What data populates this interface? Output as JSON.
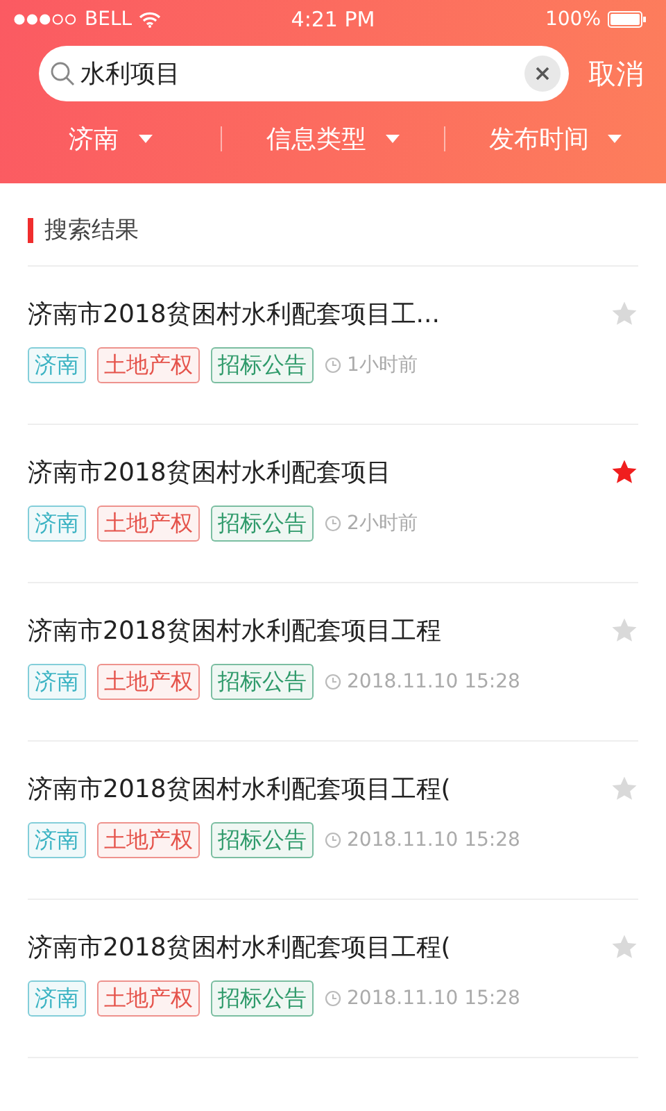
{
  "status_bar": {
    "carrier": "BELL",
    "time": "4:21 PM",
    "battery": "100%"
  },
  "search": {
    "value": "水利项目",
    "cancel": "取消"
  },
  "filters": [
    {
      "label": "济南"
    },
    {
      "label": "信息类型"
    },
    {
      "label": "发布时间"
    }
  ],
  "section_title": "搜索结果",
  "results": [
    {
      "title": "济南市2018贫困村水利配套项目工...",
      "starred": false,
      "tags": [
        {
          "label": "济南",
          "color": "#3bb3c3"
        },
        {
          "label": "土地产权",
          "color": "#e5534b"
        },
        {
          "label": "招标公告",
          "color": "#2e9a6a"
        }
      ],
      "time": "1小时前"
    },
    {
      "title": "济南市2018贫困村水利配套项目",
      "starred": true,
      "tags": [
        {
          "label": "济南",
          "color": "#3bb3c3"
        },
        {
          "label": "土地产权",
          "color": "#e5534b"
        },
        {
          "label": "招标公告",
          "color": "#2e9a6a"
        }
      ],
      "time": "2小时前"
    },
    {
      "title": "济南市2018贫困村水利配套项目工程",
      "starred": false,
      "tags": [
        {
          "label": "济南",
          "color": "#3bb3c3"
        },
        {
          "label": "土地产权",
          "color": "#e5534b"
        },
        {
          "label": "招标公告",
          "color": "#2e9a6a"
        }
      ],
      "time": "2018.11.10 15:28"
    },
    {
      "title": "济南市2018贫困村水利配套项目工程(",
      "starred": false,
      "tags": [
        {
          "label": "济南",
          "color": "#3bb3c3"
        },
        {
          "label": "土地产权",
          "color": "#e5534b"
        },
        {
          "label": "招标公告",
          "color": "#2e9a6a"
        }
      ],
      "time": "2018.11.10 15:28"
    },
    {
      "title": "济南市2018贫困村水利配套项目工程(",
      "starred": false,
      "tags": [
        {
          "label": "济南",
          "color": "#3bb3c3"
        },
        {
          "label": "土地产权",
          "color": "#e5534b"
        },
        {
          "label": "招标公告",
          "color": "#2e9a6a"
        }
      ],
      "time": "2018.11.10 15:28"
    }
  ]
}
